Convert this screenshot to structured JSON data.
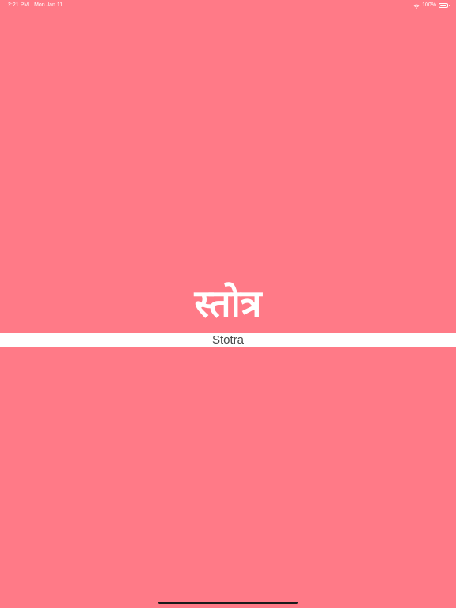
{
  "status_bar": {
    "time": "2:21 PM",
    "date": "Mon Jan 11",
    "battery_text": "100%",
    "battery_level": 1.0,
    "wifi_icon": "wifi-icon",
    "battery_icon": "battery-icon"
  },
  "main": {
    "title_devanagari": "स्तोत्र",
    "subtitle": "Stotra"
  },
  "colors": {
    "background": "#ff7a87",
    "band": "#ffffff",
    "subtitle_text": "#4a4a4a",
    "home_indicator": "#1a1a1a"
  }
}
